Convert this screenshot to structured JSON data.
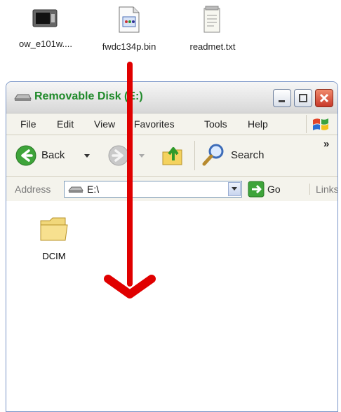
{
  "desktop_icons": [
    {
      "label": "ow_e101w....",
      "icon": "application-icon"
    },
    {
      "label": "fwdc134p.bin",
      "icon": "binary-file-icon"
    },
    {
      "label": "readmet.txt",
      "icon": "text-file-icon"
    }
  ],
  "window": {
    "title": "Removable Disk (E:)",
    "caption_buttons": {
      "minimize": "minimize",
      "maximize": "maximize",
      "close": "close"
    }
  },
  "menu": [
    "File",
    "Edit",
    "View",
    "Favorites",
    "Tools",
    "Help"
  ],
  "toolbar": {
    "back_label": "Back",
    "search_label": "Search",
    "overflow": "»"
  },
  "address": {
    "label": "Address",
    "value": "E:\\",
    "go_label": "Go",
    "links_label": "Links"
  },
  "content": {
    "items": [
      {
        "label": "DCIM",
        "icon": "folder-icon"
      }
    ]
  },
  "colors": {
    "title_text": "#1f8a2a",
    "drag_arrow": "#e00000",
    "close_button": "#d04a32"
  }
}
